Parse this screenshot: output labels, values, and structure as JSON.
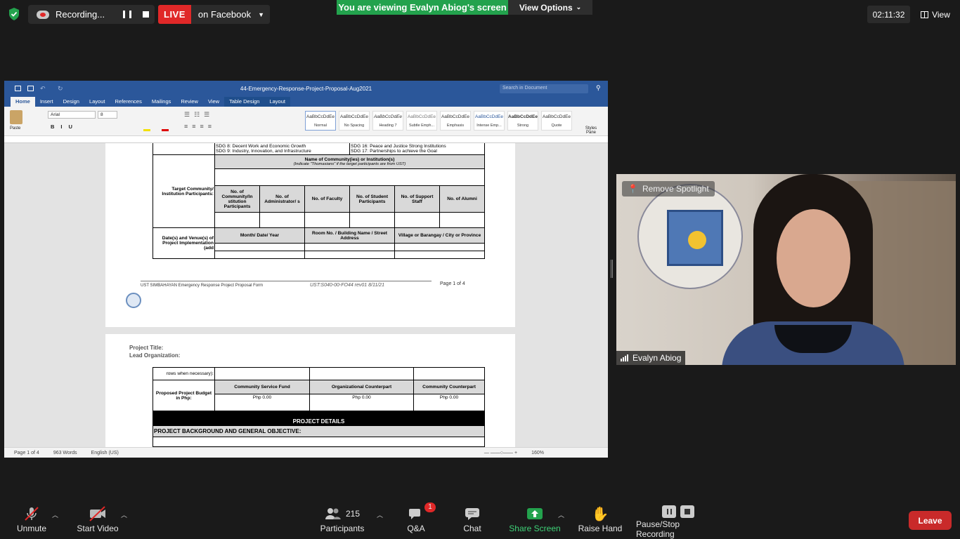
{
  "topbar": {
    "recording_label": "Recording...",
    "live_badge": "LIVE",
    "live_target": "on Facebook",
    "viewing_banner": "You are viewing Evalyn Abiog's screen",
    "view_options": "View Options",
    "timer": "02:11:32",
    "view_label": "View"
  },
  "word": {
    "title": "44-Emergency-Response-Project-Proposal-Aug2021",
    "search_placeholder": "Search in Document",
    "tabs": [
      "Home",
      "Insert",
      "Design",
      "Layout",
      "References",
      "Mailings",
      "Review",
      "View",
      "Table Design",
      "Layout"
    ],
    "font_name": "Arial",
    "font_size": "8",
    "paste": "Paste",
    "styles": [
      {
        "sample": "AaBbCcDdEe",
        "name": "Normal"
      },
      {
        "sample": "AaBbCcDdEe",
        "name": "No Spacing"
      },
      {
        "sample": "AaBbCcDdEe",
        "name": "Heading 7"
      },
      {
        "sample": "AaBbCcDdEe",
        "name": "Subtle Emph..."
      },
      {
        "sample": "AaBbCcDdEe",
        "name": "Emphasis"
      },
      {
        "sample": "AaBbCcDdEe",
        "name": "Intense Emp..."
      },
      {
        "sample": "AaBbCcDdEe",
        "name": "Strong"
      },
      {
        "sample": "AaBbCcDdEe",
        "name": "Quote"
      }
    ],
    "styles_pane": "Styles Pane",
    "status": {
      "page": "Page 1 of 4",
      "words": "963 Words",
      "language": "English (US)",
      "zoom": "160%"
    }
  },
  "doc": {
    "sdg_left_1": "SDG 8: Decent Work and Economic Growth",
    "sdg_left_2": "SDG 9:  Industry, Innovation, and Infrastructure",
    "sdg_right_1": "SDG 16: Peace and Justice Strong Institutions",
    "sdg_right_2": "SDG 17: Partnerships to achieve the Goal",
    "target_label": "Target Community/ Institution Participants:",
    "community_header": "Name of Community(ies) or Institution(s)",
    "community_note": "(Indicate \"Thomasians\" if the target participants are from UST)",
    "participant_cols": [
      "No. of Community/In stitution Participants",
      "No. of Administrator/ s",
      "No. of Faculty",
      "No. of Student Participants",
      "No. of Support Staff",
      "No. of Alumni"
    ],
    "date_label": "Date(s) and Venue(s) of Project Implementation (add",
    "date_cols": [
      "Month/ Date/ Year",
      "Room No. / Building Name / Street Address",
      "Village or Barangay / City or Province"
    ],
    "footer_left": "UST SIMBAHAYAN Emergency Response Project Proposal Form",
    "footer_code": "UST:S040-00-FO44 rev01 8/11/21",
    "footer_page": "Page 1 of 4",
    "page2_title": "Project Title:",
    "page2_org": "Lead Organization:",
    "rows_when": "rows when necessary):",
    "budget_label": "Proposed Project Budget in Php:",
    "budget_cols": [
      "Community Service Fund",
      "Organizational Counterpart",
      "Community Counterpart"
    ],
    "budget_vals": [
      "Php 0.00",
      "Php 0.00",
      "Php 0.00"
    ],
    "project_details": "PROJECT DETAILS",
    "background": "PROJECT BACKGROUND AND GENERAL OBJECTIVE:"
  },
  "video": {
    "remove_spotlight": "Remove Spotlight",
    "name": "Evalyn Abiog"
  },
  "toolbar": {
    "unmute": "Unmute",
    "start_video": "Start Video",
    "participants": "Participants",
    "participant_count": "215",
    "qa": "Q&A",
    "qa_badge": "1",
    "chat": "Chat",
    "share_screen": "Share Screen",
    "raise_hand": "Raise Hand",
    "pause_stop": "Pause/Stop Recording",
    "leave": "Leave"
  }
}
